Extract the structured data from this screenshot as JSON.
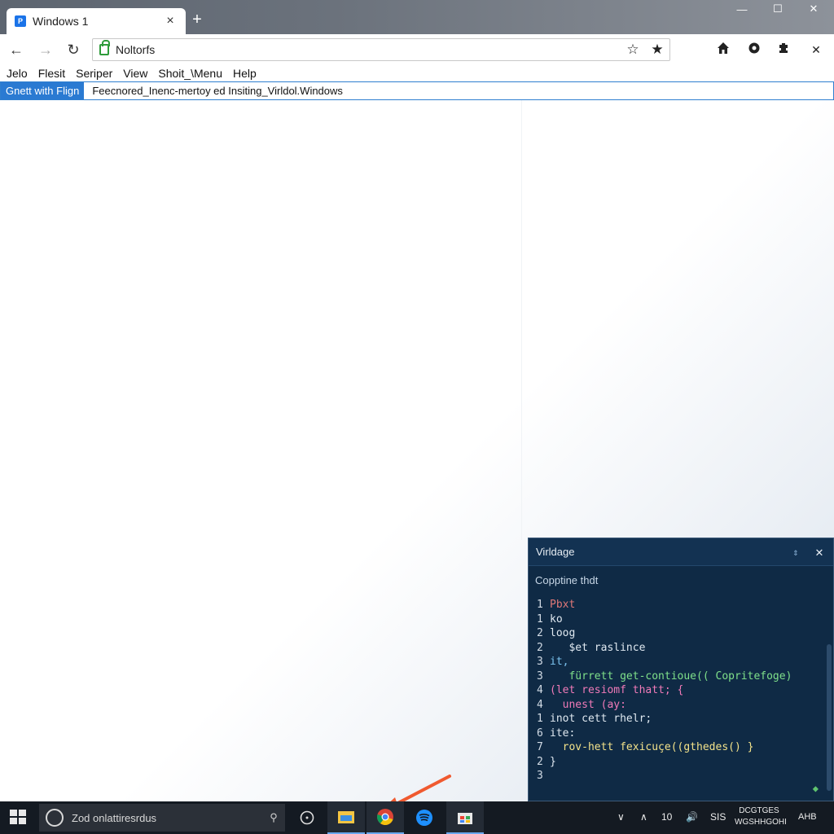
{
  "window": {
    "tab_title": "Windows 1",
    "tab_favicon": "P",
    "tab_close": "×",
    "new_tab": "+",
    "minimize": "—",
    "maximize": "☐",
    "close": "✕"
  },
  "toolbar": {
    "back": "←",
    "forward": "→",
    "reload": "↻",
    "address": "Noltorfs",
    "star1": "☆",
    "star2": "★",
    "icons": [
      "home-icon",
      "settings-icon",
      "extension-icon",
      "close-icon"
    ]
  },
  "menubar": {
    "items": [
      "Jelo",
      "Flesit",
      "Seriper",
      "View",
      "Shoit_\\Menu",
      "Help"
    ]
  },
  "infobar": {
    "button": "Gnett with Flign",
    "text": "Feecnored_Inenc-mertoy ed Insiting_Virldol.Windows"
  },
  "code_panel": {
    "title": "Virldage",
    "pin": "⇕",
    "close": "✕",
    "subtitle": "Copptine thdt",
    "lines": [
      {
        "num": "1",
        "text": "Pbxt",
        "color": "#e07878"
      },
      {
        "num": "1",
        "text": "ko",
        "color": "#dfe8f0"
      },
      {
        "num": "2",
        "text": "loog",
        "color": "#dfe8f0"
      },
      {
        "num": "2",
        "text": "   $et raslince",
        "color": "#dfe8f0"
      },
      {
        "num": "3",
        "text": "it,",
        "color": "#7cc4f0"
      },
      {
        "num": "3",
        "text": "   fürrett get-contioue(( Copritefoge)",
        "color": "#7fe08a"
      },
      {
        "num": "4",
        "text": "(let resiomf thatt; {",
        "color": "#f07ab8"
      },
      {
        "num": "4",
        "text": "  unest (ay:",
        "color": "#f07ab8"
      },
      {
        "num": "1",
        "text": "inot cett rhelr;",
        "color": "#dfe8f0"
      },
      {
        "num": "6",
        "text": "ite:",
        "color": "#dfe8f0"
      },
      {
        "num": "7",
        "text": "  rov-hett fexicuçe((gthedes() }",
        "color": "#f3e28a"
      },
      {
        "num": "2",
        "text": "}",
        "color": "#dfe8f0"
      },
      {
        "num": "3",
        "text": "",
        "color": "#dfe8f0"
      }
    ]
  },
  "taskbar": {
    "search_text": "Zod onlattiresrdus",
    "mic": "⚲",
    "apps": [
      "cortana-icon",
      "file-explorer-icon",
      "chrome-icon",
      "spotify-icon",
      "store-icon"
    ],
    "tray_chevron": "∨",
    "tray_up": "∧",
    "tray_num": "10",
    "tray_icon": "🔊",
    "tray_label": "SIS",
    "clock_line1": "DCGTGES",
    "clock_line2": "WGSHHGOHI",
    "lang": "AHB"
  },
  "colors": {
    "accent": "#2a7ad2",
    "panel_bg": "#0f2a45",
    "taskbar_bg": "#141a22",
    "arrow": "#f05a30"
  }
}
